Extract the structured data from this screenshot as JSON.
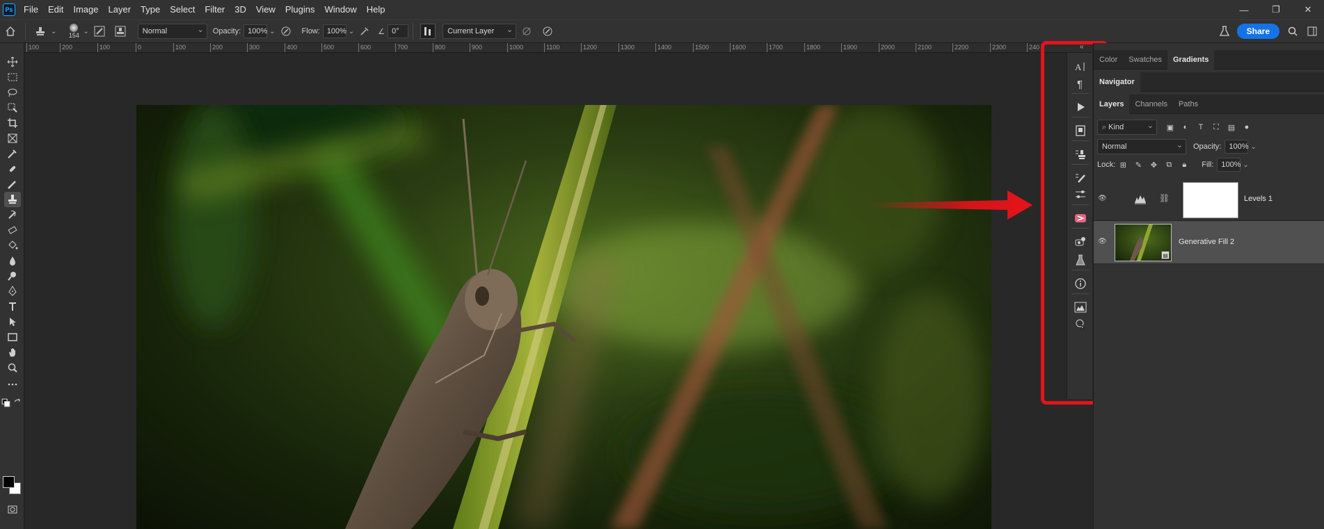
{
  "app": {
    "logo_text": "Ps",
    "menu": [
      "File",
      "Edit",
      "Image",
      "Layer",
      "Type",
      "Select",
      "Filter",
      "3D",
      "View",
      "Plugins",
      "Window",
      "Help"
    ],
    "window_controls": [
      "—",
      "❐",
      "✕"
    ]
  },
  "options_bar": {
    "brush_size": "154",
    "mode_label": "Normal",
    "opacity_label": "Opacity:",
    "opacity_value": "100%",
    "flow_label": "Flow:",
    "flow_value": "100%",
    "angle_value": "0°",
    "sample_label": "Current Layer",
    "share_label": "Share"
  },
  "ruler": {
    "ticks": [
      "100",
      "200",
      "100",
      "0",
      "100",
      "200",
      "300",
      "400",
      "500",
      "600",
      "700",
      "800",
      "900",
      "1000",
      "1100",
      "1200",
      "1300",
      "1400",
      "1500",
      "1600",
      "1700",
      "1800",
      "1900",
      "2000",
      "2100",
      "2200",
      "2300",
      "240"
    ]
  },
  "panels": {
    "color_tabs": [
      "Color",
      "Swatches",
      "Gradients"
    ],
    "color_active": "Gradients",
    "navigator_tab": "Navigator",
    "layer_tabs": [
      "Layers",
      "Channels",
      "Paths"
    ],
    "layers_active": "Layers",
    "filter_kind": "Kind",
    "blend_mode": "Normal",
    "opacity_label": "Opacity:",
    "opacity_value": "100%",
    "lock_label": "Lock:",
    "fill_label": "Fill:",
    "fill_value": "100%",
    "layers": [
      {
        "name": "Levels 1",
        "selected": false
      },
      {
        "name": "Generative Fill 2",
        "selected": true
      }
    ]
  },
  "icon_strip": [
    "character-icon",
    "paragraph-icon",
    "actions-icon",
    "properties-icon",
    "clone-source-icon",
    "brush-settings-icon",
    "adjustments-icon",
    "libraries-icon",
    "content-credentials-icon",
    "beaker-icon",
    "info-icon",
    "histogram-icon",
    "learn-icon"
  ],
  "colors": {
    "highlight": "#e5131a",
    "share_button": "#1473e6"
  }
}
